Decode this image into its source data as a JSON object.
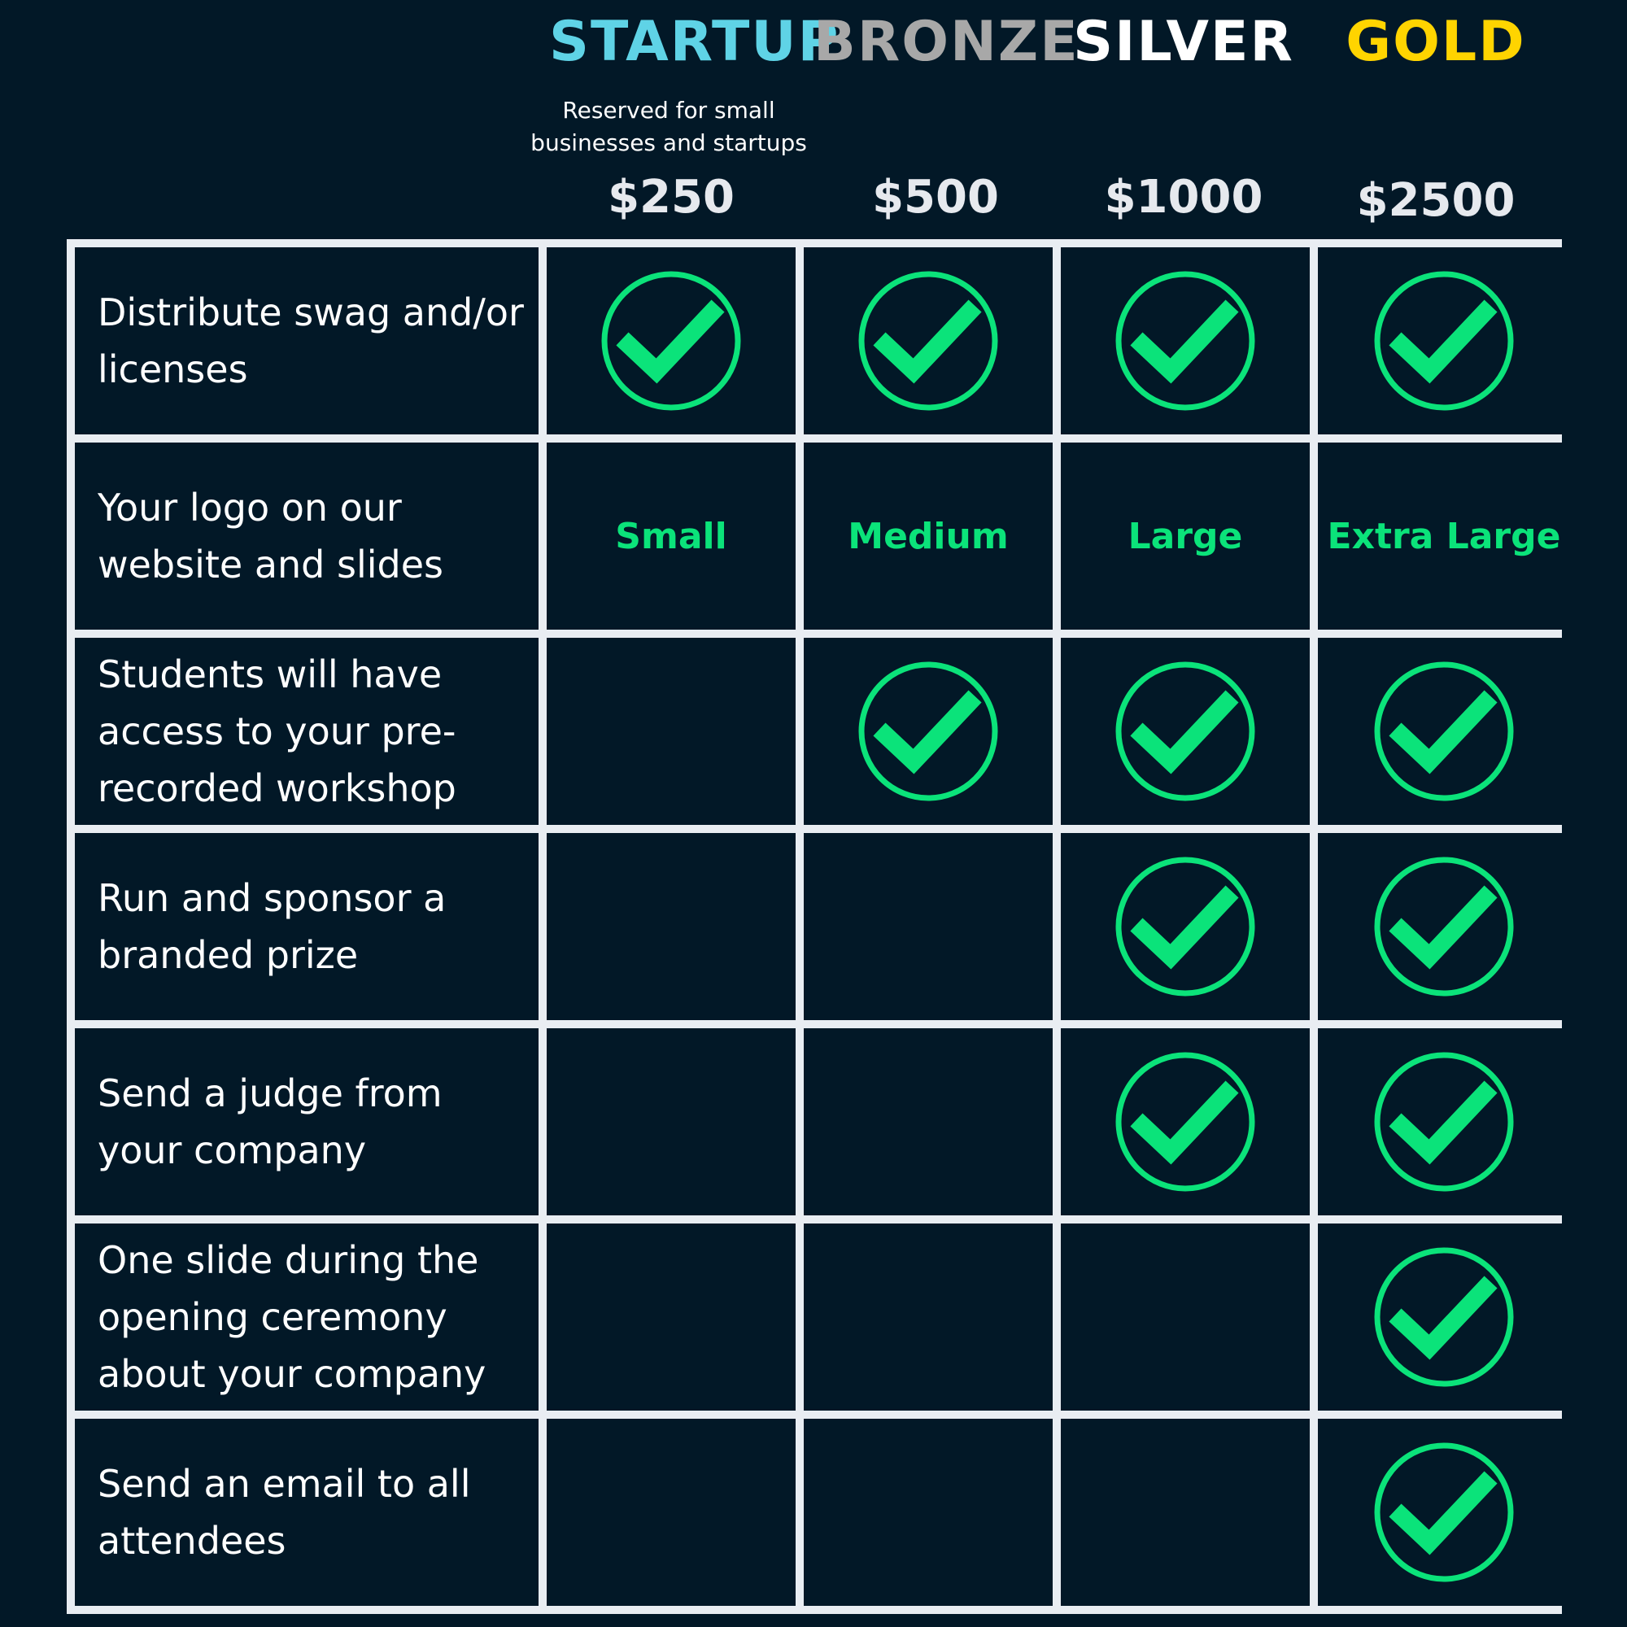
{
  "colors": {
    "background": "#021827",
    "grid_lines": "#e9edf2",
    "check_green": "#0be37a"
  },
  "tiers": [
    {
      "name": "STARTUP",
      "price": "$250",
      "color": "#5fd3e6",
      "note": "Reserved for small businesses and startups"
    },
    {
      "name": "BRONZE",
      "price": "$500",
      "color": "#a8a8a8"
    },
    {
      "name": "SILVER",
      "price": "$1000",
      "color": "#ffffff"
    },
    {
      "name": "GOLD",
      "price": "$2500",
      "color": "#ffd400"
    }
  ],
  "rows": [
    {
      "label": "Distribute swag and/or licenses",
      "cells": [
        "check",
        "check",
        "check",
        "check"
      ]
    },
    {
      "label": "Your logo on our website and slides",
      "cells": [
        "Small",
        "Medium",
        "Large",
        "Extra Large"
      ]
    },
    {
      "label": "Students will have access to your pre-recorded workshop",
      "cells": [
        "",
        "check",
        "check",
        "check"
      ]
    },
    {
      "label": "Run and sponsor a branded prize",
      "cells": [
        "",
        "",
        "check",
        "check"
      ]
    },
    {
      "label": "Send a judge from your company",
      "cells": [
        "",
        "",
        "check",
        "check"
      ]
    },
    {
      "label": "One slide during the opening ceremony about your company",
      "cells": [
        "",
        "",
        "",
        "check"
      ]
    },
    {
      "label": "Send an email to all attendees",
      "cells": [
        "",
        "",
        "",
        "check"
      ]
    }
  ]
}
